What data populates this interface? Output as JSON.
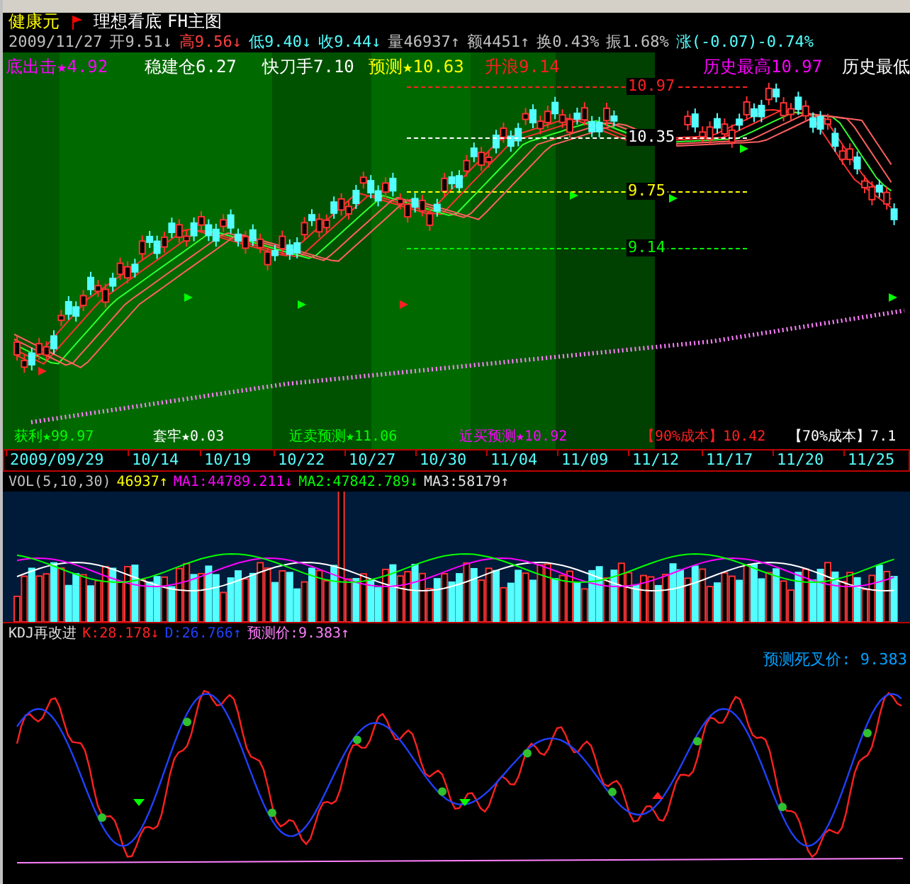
{
  "header": {
    "stock_name": "健康元",
    "indicator_name": "理想看底",
    "main_chart_name": "FH主图"
  },
  "quote": [
    {
      "text": "2009/11/27",
      "color": "#c0c0c0"
    },
    {
      "text": "开9.51↓",
      "color": "#c0c0c0"
    },
    {
      "text": "高9.56↓",
      "color": "#ff4040"
    },
    {
      "text": "低9.40↓",
      "color": "#54ffff"
    },
    {
      "text": "收9.44↓",
      "color": "#54ffff"
    },
    {
      "text": "量46937↑",
      "color": "#c0c0c0"
    },
    {
      "text": "额4451↑",
      "color": "#c0c0c0"
    },
    {
      "text": "换0.43%",
      "color": "#c0c0c0"
    },
    {
      "text": "振1.68%",
      "color": "#c0c0c0"
    },
    {
      "text": "涨(-0.07)-0.74%",
      "color": "#54ffff"
    }
  ],
  "main_chart": {
    "top_labels": [
      {
        "text": "底出击★4.92",
        "color": "#ff00ff"
      },
      {
        "text": "稳建仓6.27",
        "color": "#ffffff"
      },
      {
        "text": "快刀手7.10",
        "color": "#ffffff"
      },
      {
        "text": "预测★10.63",
        "color": "#ffff00"
      },
      {
        "text": "升浪9.14",
        "color": "#ff2020"
      },
      {
        "text": "历史最高10.97",
        "color": "#ff00ff"
      },
      {
        "text": "历史最低",
        "color": "#ffffff"
      }
    ],
    "price_levels": [
      {
        "text": "10.97",
        "color": "#ff2020"
      },
      {
        "text": "10.35",
        "color": "#ffffff"
      },
      {
        "text": "9.75",
        "color": "#ffff00"
      },
      {
        "text": "9.14",
        "color": "#00ff00"
      }
    ],
    "bottom_labels": [
      {
        "text": "获利★99.97",
        "color": "#00ff00"
      },
      {
        "text": "套牢★0.03",
        "color": "#ffffff"
      },
      {
        "text": "近卖预测★11.06",
        "color": "#00ff00"
      },
      {
        "text": "近买预测★10.92",
        "color": "#ff00ff"
      },
      {
        "text": "【90%成本】10.42",
        "color": "#ff2020"
      },
      {
        "text": "【70%成本】7.1",
        "color": "#ffffff"
      }
    ]
  },
  "date_axis": [
    "2009/09/29",
    "10/14",
    "10/19",
    "10/22",
    "10/27",
    "10/30",
    "11/04",
    "11/09",
    "11/12",
    "11/17",
    "11/20",
    "11/25"
  ],
  "volume": {
    "labels": [
      {
        "text": "VOL(5,10,30)",
        "color": "#c0c0c0"
      },
      {
        "text": "46937↑",
        "color": "#ffff00"
      },
      {
        "text": "MA1:44789.211↓",
        "color": "#ff00ff"
      },
      {
        "text": "MA2:47842.789↓",
        "color": "#00ff00"
      },
      {
        "text": "MA3:58179↑",
        "color": "#e0e0e0"
      }
    ]
  },
  "kdj": {
    "labels": [
      {
        "text": "KDJ再改进",
        "color": "#e0e0e0"
      },
      {
        "text": "K:28.178↓",
        "color": "#ff2020"
      },
      {
        "text": "D:26.766↑",
        "color": "#2040ff"
      },
      {
        "text": "预测价:9.383↑",
        "color": "#ff80ff"
      }
    ],
    "side_label": "预测死叉价: 9.383"
  }
}
